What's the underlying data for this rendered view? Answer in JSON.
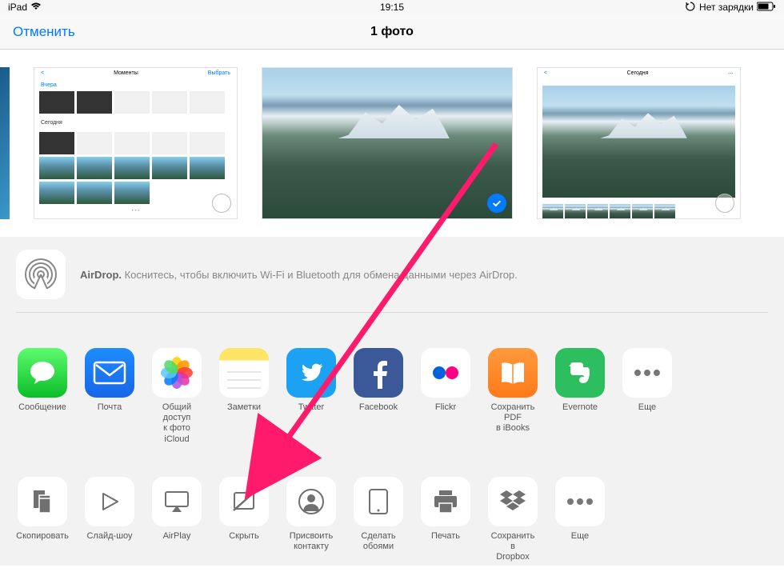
{
  "status": {
    "device": "iPad",
    "time": "19:15",
    "battery": "Нет зарядки"
  },
  "nav": {
    "cancel": "Отменить",
    "title": "1 фото"
  },
  "airdrop": {
    "bold": "AirDrop.",
    "rest": " Коснитесь, чтобы включить Wi-Fi и Bluetooth для обмена данными через AirDrop."
  },
  "apps": {
    "messages": "Сообщение",
    "mail": "Почта",
    "photos": "Общий доступ\nк фото iCloud",
    "notes": "Заметки",
    "twitter": "Twitter",
    "facebook": "Facebook",
    "flickr": "Flickr",
    "ibooks": "Сохранить PDF\nв iBooks",
    "evernote": "Evernote",
    "more": "Еще"
  },
  "actions": {
    "copy": "Скопировать",
    "slideshow": "Слайд-шоу",
    "airplay": "AirPlay",
    "hide": "Скрыть",
    "contact": "Присвоить\nконтакту",
    "wallpaper": "Сделать\nобоями",
    "print": "Печать",
    "dropbox": "Сохранить в\nDropbox",
    "more": "Еще"
  }
}
